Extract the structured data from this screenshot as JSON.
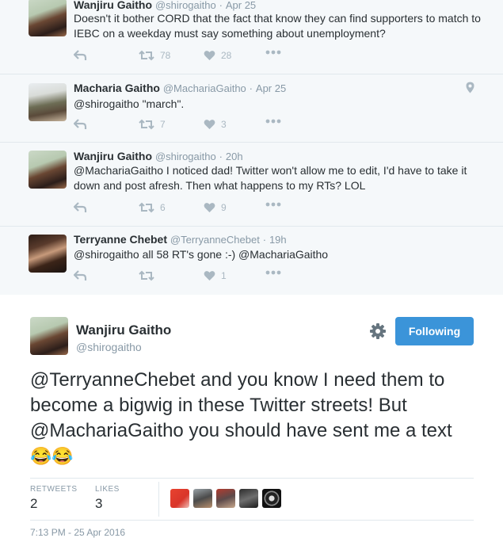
{
  "thread": [
    {
      "name": "Wanjiru Gaitho",
      "handle": "@shirogaitho",
      "time": "Apr 25",
      "text": "Doesn't it bother CORD that the fact that know they can find supporters to match to IEBC on a weekday must say something about unemployment?",
      "retweets": "78",
      "likes": "28"
    },
    {
      "name": "Macharia Gaitho",
      "handle": "@MachariaGaitho",
      "time": "Apr 25",
      "text": "@shirogaitho \"march\".",
      "retweets": "7",
      "likes": "3"
    },
    {
      "name": "Wanjiru Gaitho",
      "handle": "@shirogaitho",
      "time": "20h",
      "text": "@MachariaGaitho I noticed dad! Twitter won't allow me to edit, I'd have to take it down and post afresh. Then what happens to my RTs? LOL",
      "retweets": "6",
      "likes": "9"
    },
    {
      "name": "Terryanne Chebet",
      "handle": "@TerryanneChebet",
      "time": "19h",
      "text": "@shirogaitho all 58 RT's gone  :-) @MachariaGaitho",
      "retweets": "",
      "likes": "1"
    }
  ],
  "main": {
    "name": "Wanjiru Gaitho",
    "handle": "@shirogaitho",
    "follow_label": "Following",
    "text": "@TerryanneChebet and you know I need them to become a bigwig in these Twitter streets! But @MachariaGaitho you should have sent me a text",
    "emoji": "😂😂",
    "retweets_label": "RETWEETS",
    "retweets": "2",
    "likes_label": "LIKES",
    "likes": "3",
    "timestamp": "7:13 PM - 25 Apr 2016"
  },
  "colors": {
    "accent": "#3b94d9",
    "muted": "#8899a6",
    "icon": "#aab8c2",
    "thread_bg": "#f5f8fa"
  }
}
